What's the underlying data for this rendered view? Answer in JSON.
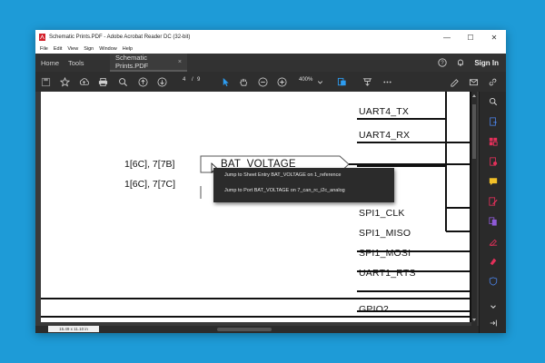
{
  "window": {
    "title": "Schematic Prints.PDF - Adobe Acrobat Reader DC (32-bit)",
    "minimize": "—",
    "maximize": "☐",
    "close": "✕"
  },
  "menubar": [
    "File",
    "Edit",
    "View",
    "Sign",
    "Window",
    "Help"
  ],
  "tabs": {
    "home": "Home",
    "tools": "Tools",
    "document": "Schematic Prints.PDF",
    "document_close": "×",
    "help": "?",
    "signin": "Sign In"
  },
  "toolbar": {
    "current_page": "4",
    "page_separator": "/",
    "total_pages": "9",
    "zoom": "400%"
  },
  "schematic": {
    "signals": [
      "UART4_TX",
      "UART4_RX",
      "BAT_VOLTAGE",
      "SPI1_CLK",
      "SPI1_MISO",
      "SPI1_MOSI",
      "UART1_RTS",
      "GPIO2"
    ],
    "references": [
      "1[6C], 7[7B]",
      "1[6C], 7[7C]"
    ]
  },
  "context_menu": {
    "items": [
      "Jump to Sheet Entry BAT_VOLTAGE on 1_reference",
      "Jump to Port BAT_VOLTAGE on 7_can_rc_i2c_analog"
    ]
  },
  "status": {
    "page_size": "15.49 x 11.10 in"
  },
  "icons": {
    "toolbar": [
      "save-icon",
      "bookmark-star-icon",
      "upload-icon",
      "print-icon",
      "search-icon",
      "page-up-icon",
      "page-down-icon",
      "select-cursor-icon",
      "hand-icon",
      "zoom-out-icon",
      "zoom-in-icon",
      "zoom-dropdown-icon",
      "page-fit-icon",
      "annotate-icon",
      "more-icon",
      "sign-icon",
      "email-icon",
      "link-icon"
    ],
    "sidebar": [
      "search-icon",
      "export-pdf-icon",
      "organize-pages-icon",
      "create-pdf-icon",
      "comment-icon",
      "edit-pdf-icon",
      "combine-files-icon",
      "fill-sign-icon",
      "protect-icon",
      "chevron-down-icon",
      "expand-panel-icon"
    ]
  },
  "colors": {
    "background": "#1e9bd7",
    "acrobat_red": "#d4202a",
    "sidebar_pink": "#e3305a",
    "sidebar_blue": "#4a7fe0",
    "sidebar_yellow": "#f2c028",
    "sidebar_purple": "#8f5ad6"
  }
}
